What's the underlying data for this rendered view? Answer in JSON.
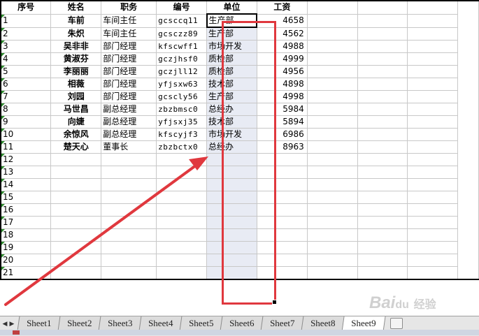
{
  "headers": [
    "序号",
    "姓名",
    "职务",
    "编号",
    "单位",
    "工资"
  ],
  "rows": [
    {
      "no": "1",
      "name": "车前",
      "title": "车间主任",
      "code": "gcsccq11",
      "unit": "生产部",
      "salary": "4658"
    },
    {
      "no": "2",
      "name": "朱炽",
      "title": "车间主任",
      "code": "gcsczz89",
      "unit": "生产部",
      "salary": "4562"
    },
    {
      "no": "3",
      "name": "吴非非",
      "title": "部门经理",
      "code": "kfscwff1",
      "unit": "市场开发",
      "salary": "4988"
    },
    {
      "no": "4",
      "name": "黄淑芬",
      "title": "部门经理",
      "code": "gczjhsf0",
      "unit": "质检部",
      "salary": "4999"
    },
    {
      "no": "5",
      "name": "李丽丽",
      "title": "部门经理",
      "code": "gczjll12",
      "unit": "质检部",
      "salary": "4956"
    },
    {
      "no": "6",
      "name": "相薇",
      "title": "部门经理",
      "code": "yfjsxw63",
      "unit": "技术部",
      "salary": "4898"
    },
    {
      "no": "7",
      "name": "刘园",
      "title": "部门经理",
      "code": "gcscly56",
      "unit": "生产部",
      "salary": "4998"
    },
    {
      "no": "8",
      "name": "马世昌",
      "title": "副总经理",
      "code": "zbzbmsc0",
      "unit": "总经办",
      "salary": "5984"
    },
    {
      "no": "9",
      "name": "向婕",
      "title": "副总经理",
      "code": "yfjsxj35",
      "unit": "技术部",
      "salary": "5894"
    },
    {
      "no": "10",
      "name": "余惊风",
      "title": "副总经理",
      "code": "kfscyjf3",
      "unit": "市场开发",
      "salary": "6986"
    },
    {
      "no": "11",
      "name": "楚天心",
      "title": "董事长",
      "code": "zbzbctx0",
      "unit": "总经办",
      "salary": "8963"
    }
  ],
  "empty_row_numbers": [
    "12",
    "13",
    "14",
    "15",
    "16",
    "17",
    "18",
    "19",
    "20",
    "21"
  ],
  "sheet_tabs": [
    "Sheet1",
    "Sheet2",
    "Sheet3",
    "Sheet4",
    "Sheet5",
    "Sheet6",
    "Sheet7",
    "Sheet8",
    "Sheet9"
  ],
  "active_tab": "Sheet9",
  "watermark": {
    "brand": "Bai",
    "suffix": "du",
    "label": "经验"
  },
  "colors": {
    "highlight": "#e0383e",
    "selection_fill": "#e8ebf4",
    "accent_green": "#2e8b2e"
  }
}
